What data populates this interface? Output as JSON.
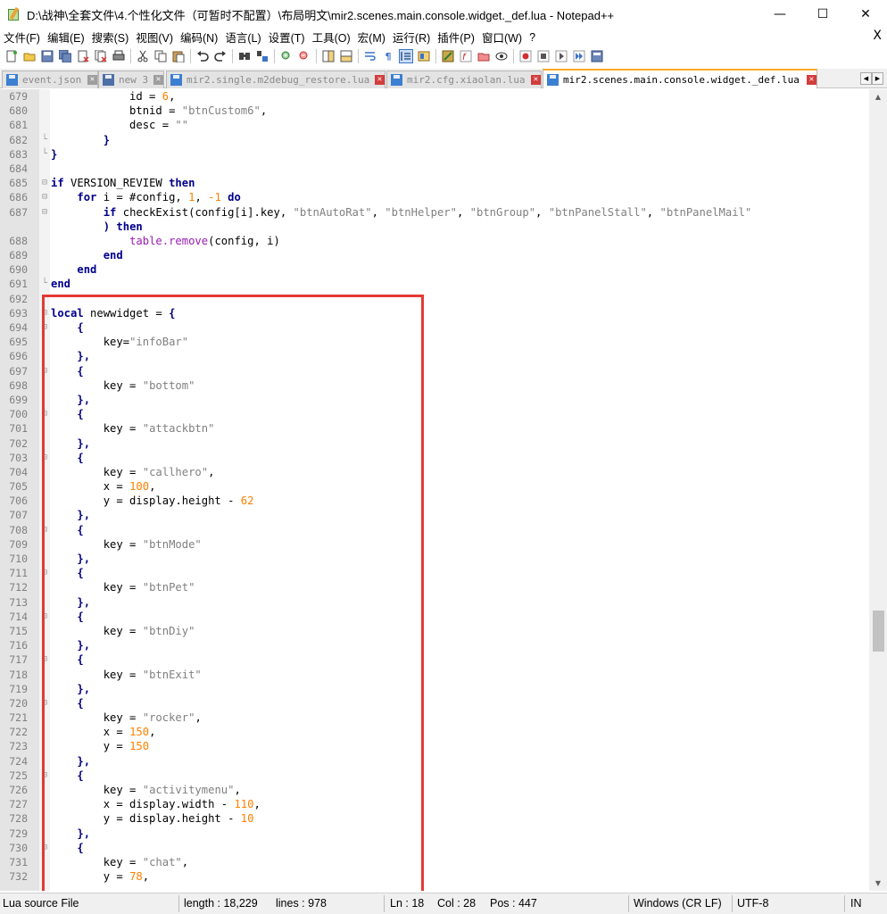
{
  "window": {
    "title": "D:\\战神\\全套文件\\4.个性化文件（可暂时不配置）\\布局明文\\mir2.scenes.main.console.widget._def.lua - Notepad++"
  },
  "menu": [
    "文件(F)",
    "编辑(E)",
    "搜索(S)",
    "视图(V)",
    "编码(N)",
    "语言(L)",
    "设置(T)",
    "工具(O)",
    "宏(M)",
    "运行(R)",
    "插件(P)",
    "窗口(W)",
    "?"
  ],
  "menu_close": "X",
  "toolbar_icons": [
    "new-file",
    "open-file",
    "save",
    "save-all",
    "close",
    "close-all",
    "print",
    "cut",
    "copy",
    "paste",
    "undo",
    "redo",
    "find",
    "replace",
    "zoom-in",
    "zoom-out",
    "sync-v",
    "sync-h",
    "word-wrap",
    "show-all",
    "indent-guide",
    "doc-map",
    "function-list",
    "folder-workspace",
    "monitor",
    "record-macro",
    "stop-macro",
    "play-macro",
    "run-multiple",
    "save-macro"
  ],
  "tabs": [
    {
      "label": "event.json",
      "active": false,
      "close": "grey"
    },
    {
      "label": "new 3",
      "active": false,
      "close": "grey"
    },
    {
      "label": "mir2.single.m2debug_restore.lua",
      "active": false,
      "close": "red"
    },
    {
      "label": "mir2.cfg.xiaolan.lua",
      "active": false,
      "close": "red"
    },
    {
      "label": "mir2.scenes.main.console.widget._def.lua",
      "active": true,
      "close": "red"
    }
  ],
  "editor": {
    "lines": [
      {
        "n": "679",
        "f": "",
        "code": [
          [
            "            id = ",
            ""
          ],
          [
            "6",
            "num"
          ],
          [
            ",",
            ""
          ]
        ]
      },
      {
        "n": "680",
        "f": "",
        "code": [
          [
            "            btnid = ",
            ""
          ],
          [
            "\"btnCustom6\"",
            "str"
          ],
          [
            ",",
            ""
          ]
        ]
      },
      {
        "n": "681",
        "f": "",
        "code": [
          [
            "            desc = ",
            ""
          ],
          [
            "\"\"",
            "str"
          ]
        ]
      },
      {
        "n": "682",
        "f": "└",
        "code": [
          [
            "        }",
            "op"
          ]
        ]
      },
      {
        "n": "683",
        "f": "└",
        "code": [
          [
            "}",
            "op"
          ]
        ]
      },
      {
        "n": "684",
        "f": "",
        "code": []
      },
      {
        "n": "685",
        "f": "⊟",
        "code": [
          [
            "if",
            "kw"
          ],
          [
            " VERSION_REVIEW ",
            ""
          ],
          [
            "then",
            "kw"
          ]
        ]
      },
      {
        "n": "686",
        "f": "⊟",
        "code": [
          [
            "    ",
            ""
          ],
          [
            "for",
            "kw"
          ],
          [
            " i = #config, ",
            ""
          ],
          [
            "1",
            "num"
          ],
          [
            ", ",
            ""
          ],
          [
            "-1",
            "num"
          ],
          [
            " ",
            ""
          ],
          [
            "do",
            "kw"
          ]
        ]
      },
      {
        "n": "687",
        "f": "⊟",
        "code": [
          [
            "        ",
            ""
          ],
          [
            "if",
            "kw"
          ],
          [
            " checkExist(config[i].key, ",
            ""
          ],
          [
            "\"btnAutoRat\"",
            "str"
          ],
          [
            ", ",
            ""
          ],
          [
            "\"btnHelper\"",
            "str"
          ],
          [
            ", ",
            ""
          ],
          [
            "\"btnGroup\"",
            "str"
          ],
          [
            ", ",
            ""
          ],
          [
            "\"btnPanelStall\"",
            "str"
          ],
          [
            ", ",
            ""
          ],
          [
            "\"btnPanelMail\"",
            "str"
          ]
        ]
      },
      {
        "n": "",
        "f": "",
        "code": [
          [
            "        ",
            ""
          ],
          [
            ")",
            "op"
          ],
          [
            " ",
            ""
          ],
          [
            "then",
            "kw"
          ]
        ]
      },
      {
        "n": "688",
        "f": "",
        "code": [
          [
            "            ",
            ""
          ],
          [
            "table.remove",
            "fn"
          ],
          [
            "(config, i)",
            ""
          ]
        ]
      },
      {
        "n": "689",
        "f": "",
        "code": [
          [
            "        ",
            ""
          ],
          [
            "end",
            "kw"
          ]
        ]
      },
      {
        "n": "690",
        "f": "",
        "code": [
          [
            "    ",
            ""
          ],
          [
            "end",
            "kw"
          ]
        ]
      },
      {
        "n": "691",
        "f": "└",
        "code": [
          [
            "end",
            "kw"
          ]
        ]
      },
      {
        "n": "692",
        "f": "",
        "code": []
      },
      {
        "n": "693",
        "f": "⊟",
        "code": [
          [
            "local",
            "kw"
          ],
          [
            " newwidget = ",
            ""
          ],
          [
            "{",
            "op"
          ]
        ]
      },
      {
        "n": "694",
        "f": "⊟",
        "code": [
          [
            "    ",
            ""
          ],
          [
            "{",
            "op"
          ]
        ]
      },
      {
        "n": "695",
        "f": "",
        "code": [
          [
            "        key=",
            ""
          ],
          [
            "\"infoBar\"",
            "str"
          ]
        ]
      },
      {
        "n": "696",
        "f": "",
        "code": [
          [
            "    ",
            ""
          ],
          [
            "},",
            "op"
          ]
        ]
      },
      {
        "n": "697",
        "f": "⊟",
        "code": [
          [
            "    ",
            ""
          ],
          [
            "{",
            "op"
          ]
        ]
      },
      {
        "n": "698",
        "f": "",
        "code": [
          [
            "        key = ",
            ""
          ],
          [
            "\"bottom\"",
            "str"
          ]
        ]
      },
      {
        "n": "699",
        "f": "",
        "code": [
          [
            "    ",
            ""
          ],
          [
            "},",
            "op"
          ]
        ]
      },
      {
        "n": "700",
        "f": "⊟",
        "code": [
          [
            "    ",
            ""
          ],
          [
            "{",
            "op"
          ]
        ]
      },
      {
        "n": "701",
        "f": "",
        "code": [
          [
            "        key = ",
            ""
          ],
          [
            "\"attackbtn\"",
            "str"
          ]
        ]
      },
      {
        "n": "702",
        "f": "",
        "code": [
          [
            "    ",
            ""
          ],
          [
            "},",
            "op"
          ]
        ]
      },
      {
        "n": "703",
        "f": "⊟",
        "code": [
          [
            "    ",
            ""
          ],
          [
            "{",
            "op"
          ]
        ]
      },
      {
        "n": "704",
        "f": "",
        "code": [
          [
            "        key = ",
            ""
          ],
          [
            "\"callhero\"",
            "str"
          ],
          [
            ",",
            ""
          ]
        ]
      },
      {
        "n": "705",
        "f": "",
        "code": [
          [
            "        x = ",
            ""
          ],
          [
            "100",
            "num"
          ],
          [
            ",",
            ""
          ]
        ]
      },
      {
        "n": "706",
        "f": "",
        "code": [
          [
            "        y = display.height - ",
            ""
          ],
          [
            "62",
            "num"
          ]
        ]
      },
      {
        "n": "707",
        "f": "",
        "code": [
          [
            "    ",
            ""
          ],
          [
            "},",
            "op"
          ]
        ]
      },
      {
        "n": "708",
        "f": "⊟",
        "code": [
          [
            "    ",
            ""
          ],
          [
            "{",
            "op"
          ]
        ]
      },
      {
        "n": "709",
        "f": "",
        "code": [
          [
            "        key = ",
            ""
          ],
          [
            "\"btnMode\"",
            "str"
          ]
        ]
      },
      {
        "n": "710",
        "f": "",
        "code": [
          [
            "    ",
            ""
          ],
          [
            "},",
            "op"
          ]
        ]
      },
      {
        "n": "711",
        "f": "⊟",
        "code": [
          [
            "    ",
            ""
          ],
          [
            "{",
            "op"
          ]
        ]
      },
      {
        "n": "712",
        "f": "",
        "code": [
          [
            "        key = ",
            ""
          ],
          [
            "\"btnPet\"",
            "str"
          ]
        ]
      },
      {
        "n": "713",
        "f": "",
        "code": [
          [
            "    ",
            ""
          ],
          [
            "},",
            "op"
          ]
        ]
      },
      {
        "n": "714",
        "f": "⊟",
        "code": [
          [
            "    ",
            ""
          ],
          [
            "{",
            "op"
          ]
        ]
      },
      {
        "n": "715",
        "f": "",
        "code": [
          [
            "        key = ",
            ""
          ],
          [
            "\"btnDiy\"",
            "str"
          ]
        ]
      },
      {
        "n": "716",
        "f": "",
        "code": [
          [
            "    ",
            ""
          ],
          [
            "},",
            "op"
          ]
        ]
      },
      {
        "n": "717",
        "f": "⊟",
        "code": [
          [
            "    ",
            ""
          ],
          [
            "{",
            "op"
          ]
        ]
      },
      {
        "n": "718",
        "f": "",
        "code": [
          [
            "        key = ",
            ""
          ],
          [
            "\"btnExit\"",
            "str"
          ]
        ]
      },
      {
        "n": "719",
        "f": "",
        "code": [
          [
            "    ",
            ""
          ],
          [
            "},",
            "op"
          ]
        ]
      },
      {
        "n": "720",
        "f": "⊟",
        "code": [
          [
            "    ",
            ""
          ],
          [
            "{",
            "op"
          ]
        ]
      },
      {
        "n": "721",
        "f": "",
        "code": [
          [
            "        key = ",
            ""
          ],
          [
            "\"rocker\"",
            "str"
          ],
          [
            ",",
            ""
          ]
        ]
      },
      {
        "n": "722",
        "f": "",
        "code": [
          [
            "        x = ",
            ""
          ],
          [
            "150",
            "num"
          ],
          [
            ",",
            ""
          ]
        ]
      },
      {
        "n": "723",
        "f": "",
        "code": [
          [
            "        y = ",
            ""
          ],
          [
            "150",
            "num"
          ]
        ]
      },
      {
        "n": "724",
        "f": "",
        "code": [
          [
            "    ",
            ""
          ],
          [
            "},",
            "op"
          ]
        ]
      },
      {
        "n": "725",
        "f": "⊟",
        "code": [
          [
            "    ",
            ""
          ],
          [
            "{",
            "op"
          ]
        ]
      },
      {
        "n": "726",
        "f": "",
        "code": [
          [
            "        key = ",
            ""
          ],
          [
            "\"activitymenu\"",
            "str"
          ],
          [
            ",",
            ""
          ]
        ]
      },
      {
        "n": "727",
        "f": "",
        "code": [
          [
            "        x = display.width - ",
            ""
          ],
          [
            "110",
            "num"
          ],
          [
            ",",
            ""
          ]
        ]
      },
      {
        "n": "728",
        "f": "",
        "code": [
          [
            "        y = display.height - ",
            ""
          ],
          [
            "10",
            "num"
          ]
        ]
      },
      {
        "n": "729",
        "f": "",
        "code": [
          [
            "    ",
            ""
          ],
          [
            "},",
            "op"
          ]
        ]
      },
      {
        "n": "730",
        "f": "⊟",
        "code": [
          [
            "    ",
            ""
          ],
          [
            "{",
            "op"
          ]
        ]
      },
      {
        "n": "731",
        "f": "",
        "code": [
          [
            "        key = ",
            ""
          ],
          [
            "\"chat\"",
            "str"
          ],
          [
            ",",
            ""
          ]
        ]
      },
      {
        "n": "732",
        "f": "",
        "code": [
          [
            "        y = ",
            ""
          ],
          [
            "78",
            "num"
          ],
          [
            ",",
            ""
          ]
        ]
      }
    ]
  },
  "status": {
    "file_type": "Lua source File",
    "length": "length : 18,229",
    "lines": "lines : 978",
    "ln": "Ln : 18",
    "col": "Col : 28",
    "pos": "Pos : 447",
    "eol": "Windows (CR LF)",
    "encoding": "UTF-8",
    "mode": "IN"
  },
  "colors": {
    "keyword": "#00008b",
    "string": "#808080",
    "number": "#ff8000",
    "highlight_box": "#e53935",
    "active_tab_accent": "#f9a825"
  }
}
